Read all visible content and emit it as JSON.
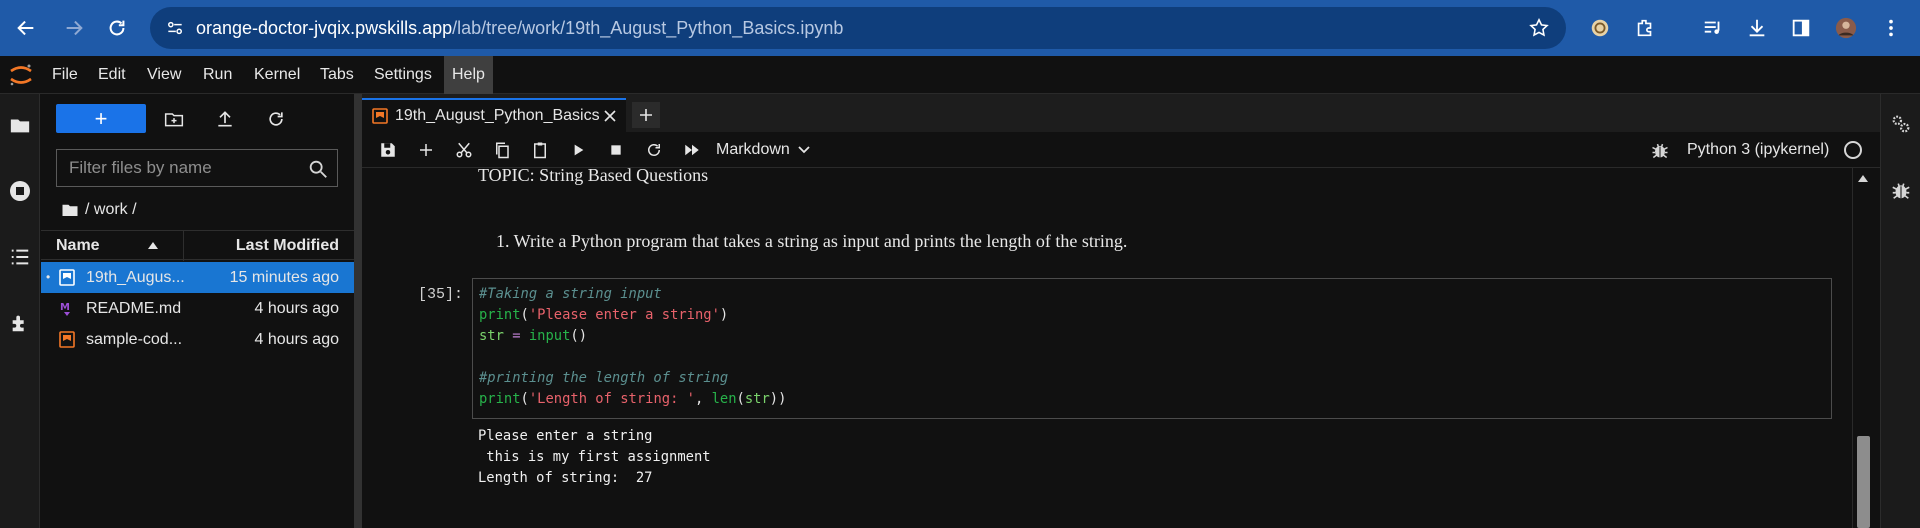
{
  "browser": {
    "url_host": "orange-doctor-jvqix.pwskills.app",
    "url_path": "/lab/tree/work/19th_August_Python_Basics.ipynb",
    "accent": "#1f5aa8"
  },
  "menubar": {
    "items": [
      "File",
      "Edit",
      "View",
      "Run",
      "Kernel",
      "Tabs",
      "Settings",
      "Help"
    ],
    "active": "Help"
  },
  "filebrowser": {
    "new_button": "+",
    "filter_placeholder": "Filter files by name",
    "breadcrumb": "/ work /",
    "col_name": "Name",
    "col_modified": "Last Modified",
    "files": [
      {
        "name": "19th_August_Python_Basics.ipynb",
        "display": "19th_Augus...",
        "modified": "15 minutes ago",
        "type": "notebook",
        "selected": true,
        "running": true
      },
      {
        "name": "README.md",
        "display": "README.md",
        "modified": "4 hours ago",
        "type": "markdown",
        "selected": false,
        "running": false
      },
      {
        "name": "sample-code",
        "display": "sample-cod...",
        "modified": "4 hours ago",
        "type": "notebook",
        "selected": false,
        "running": false
      }
    ]
  },
  "tab": {
    "title": "19th_August_Python_Basics.i"
  },
  "toolbar": {
    "cell_type": "Markdown",
    "kernel_name": "Python 3 (ipykernel)"
  },
  "notebook": {
    "topic": "TOPIC: String Based Questions",
    "question": "1. Write a Python program that takes a string as input and prints the length of the string.",
    "prompt": "[35]:",
    "code": {
      "line1": "#Taking a string input",
      "line2_fn": "print",
      "line2_str": "'Please enter a string'",
      "line3_var": "str",
      "line3_op": "=",
      "line3_fn": "input",
      "line5": "#printing the length of string",
      "line6_fn": "print",
      "line6_str": "'Length of string: '",
      "line6_fn2": "len",
      "line6_var": "str"
    },
    "output": [
      "Please enter a string",
      " this is my first assignment",
      "Length of string:  27"
    ]
  }
}
